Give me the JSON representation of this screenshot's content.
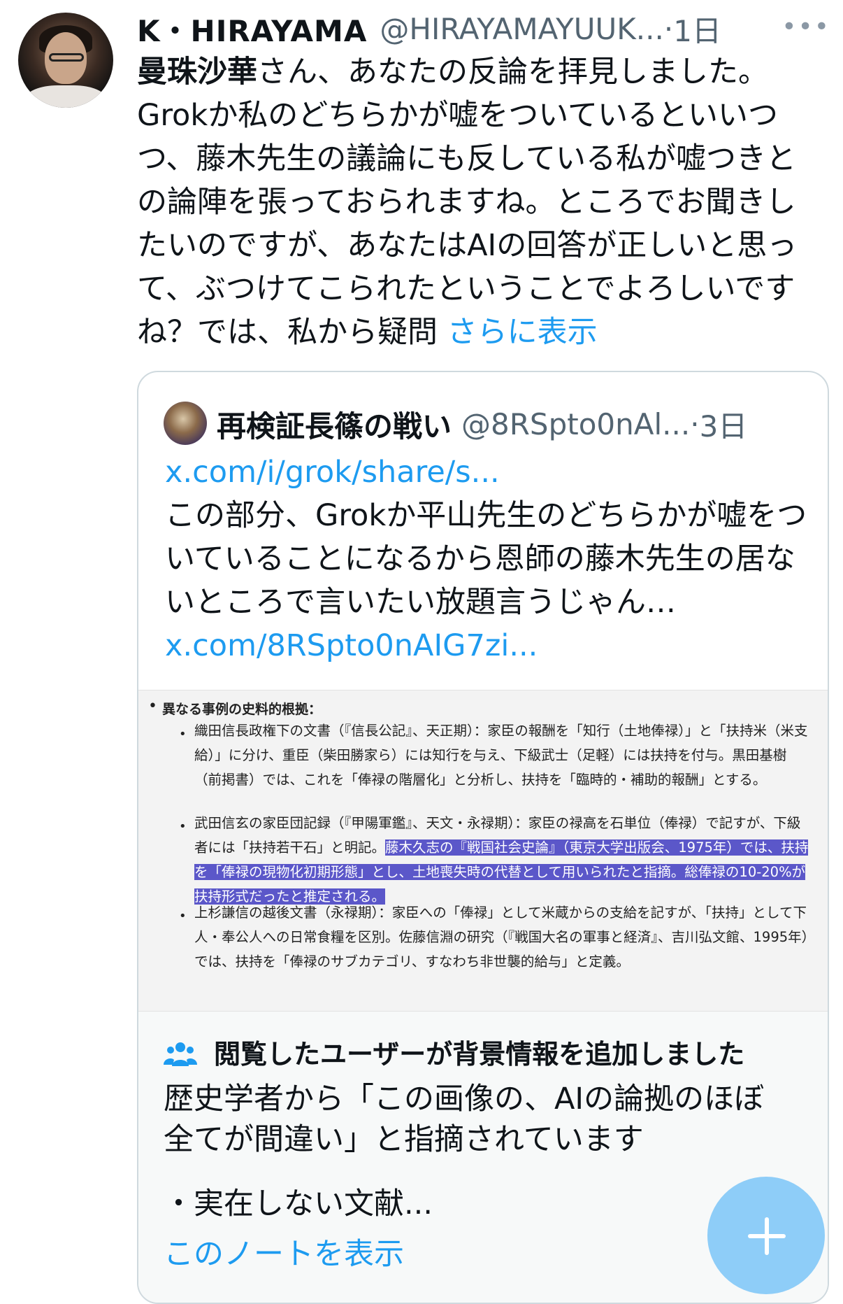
{
  "tweet": {
    "display_name": "K・HIRAYAMA",
    "handle": "@HIRAYAMAYUUK...",
    "separator": "·",
    "time": "1日",
    "more_icon": "ellipsis-icon",
    "text_mention": "曼珠沙華",
    "text_body": "さん、あなたの反論を拝見しました。Grokか私のどちらかが嘘をついているといいつつ、藤木先生の議論にも反している私が嘘つきとの論陣を張っておられますね。ところでお聞きしたいのですが、あなたはAIの回答が正しいと思って、ぶつけてこられたということでよろしいですね？では、私から疑問 ",
    "show_more": "さらに表示"
  },
  "quoted": {
    "display_name": "再検証長篠の戦い",
    "handle": "@8RSpto0nAl...",
    "separator": "·",
    "time": "3日",
    "link1": "x.com/i/grok/share/s...",
    "text": "この部分、Grokか平山先生のどちらかが嘘をついていることになるから恩師の藤木先生の居ないところで言いたい放題言うじゃん…",
    "link2": "x.com/8RSpto0nAIG7zi...",
    "image": {
      "heading": "異なる事例の史料的根拠：",
      "item1": "織田信長政権下の文書（『信長公記』、天正期）：家臣の報酬を「知行（土地俸禄）」と「扶持米（米支給）」に分け、重臣（柴田勝家ら）には知行を与え、下級武士（足軽）には扶持を付与。黒田基樹（前掲書）では、これを「俸禄の階層化」と分析し、扶持を「臨時的・補助的報酬」とする。",
      "item2_plain": "武田信玄の家臣団記録（『甲陽軍鑑』、天文・永禄期）：家臣の禄高を石単位（俸禄）で記すが、下級者には「扶持若干石」と明記。",
      "item2_highlight": "藤木久志の『戦国社会史論』（東京大学出版会、1975年）では、扶持を「俸禄の現物化初期形態」とし、土地喪失時の代替として用いられたと指摘。総俸禄の10-20%が扶持形式だったと推定される。",
      "item3": "上杉謙信の越後文書（永禄期）：家臣への「俸禄」として米蔵からの支給を記すが、「扶持」として下人・奉公人への日常食糧を区別。佐藤信淵の研究（『戦国大名の軍事と経済』、吉川弘文館、1995年）では、扶持を「俸禄のサブカテゴリ、すなわち非世襲的給与」と定義。"
    }
  },
  "community_note": {
    "icon": "people-icon",
    "title": "閲覧したユーザーが背景情報を追加しました",
    "text": "歴史学者から「この画像の、AIの論拠のほぼ全てが間違い」と指摘されています",
    "bullet": "・実在しない文献...",
    "link": "このノートを表示"
  },
  "fab": {
    "icon": "plus-icon"
  },
  "colors": {
    "link": "#1d9bf0",
    "muted": "#536471",
    "highlight": "#5b57c9",
    "fab": "#8ecdf8"
  }
}
